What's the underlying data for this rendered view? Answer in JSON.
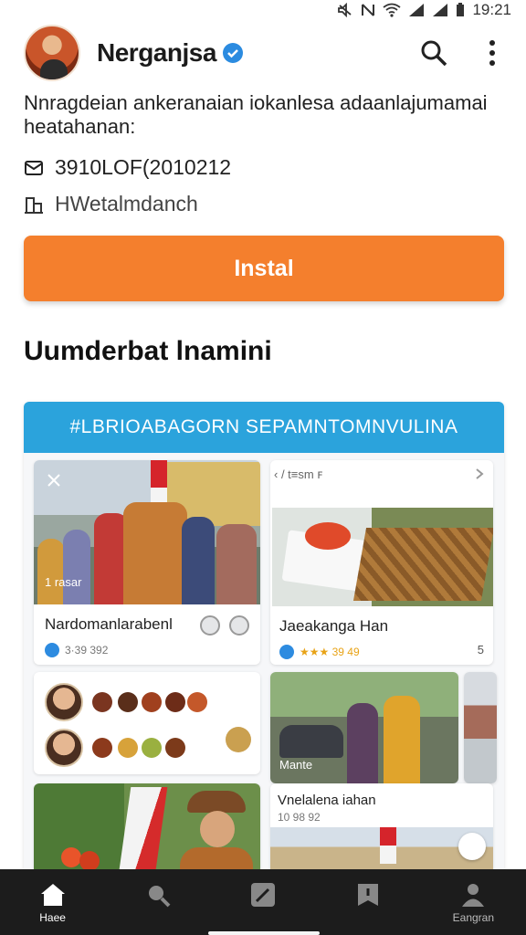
{
  "status_bar": {
    "time": "19:21",
    "icons": [
      "mute-icon",
      "nfc-icon",
      "wifi-icon",
      "signal-icon",
      "signal-icon",
      "battery-icon"
    ]
  },
  "header": {
    "app_name": "Nerganjsa",
    "verified": true,
    "actions": [
      "search-icon",
      "more-vert-icon"
    ]
  },
  "description": "Nnragdeian ankeranaian iokanlesa adaanlajumamai heatahanan:",
  "meta": [
    {
      "icon": "mail-icon",
      "text": "3910LOF(2010212"
    },
    {
      "icon": "building-icon",
      "text": "HWetalmdanch"
    }
  ],
  "install_button": {
    "label": "Instal",
    "color": "#f47f2d"
  },
  "section_title": "Uumderbat lnamini",
  "promo": {
    "banner_text": "#LBRIOABAGORN SEPAMNTOMNVULINA",
    "banner_color": "#2ba3dc",
    "tiles": [
      {
        "caption": "Nardomanlarabenl",
        "sub": "3·39 392",
        "badge": "1 rasar"
      },
      {
        "header": "‹ / t≡sm ꜰ",
        "caption": "Jaeakanga Han",
        "sub": "★★★ 39 49",
        "count": "5"
      },
      {
        "caption": "",
        "sub": ""
      },
      {
        "caption": "",
        "overlay": "Mante",
        "sub": ""
      },
      {
        "caption": "",
        "sub": ""
      },
      {
        "caption": "Vnelalena iahan",
        "sub": "10 98 92"
      }
    ]
  },
  "bottom_nav": [
    {
      "icon": "home-icon",
      "label": "Haee",
      "active": true
    },
    {
      "icon": "search-icon",
      "label": "",
      "active": false
    },
    {
      "icon": "edit-icon",
      "label": "",
      "active": false
    },
    {
      "icon": "bookmark-icon",
      "label": "",
      "active": false
    },
    {
      "icon": "profile-icon",
      "label": "Eangran",
      "active": false
    }
  ]
}
